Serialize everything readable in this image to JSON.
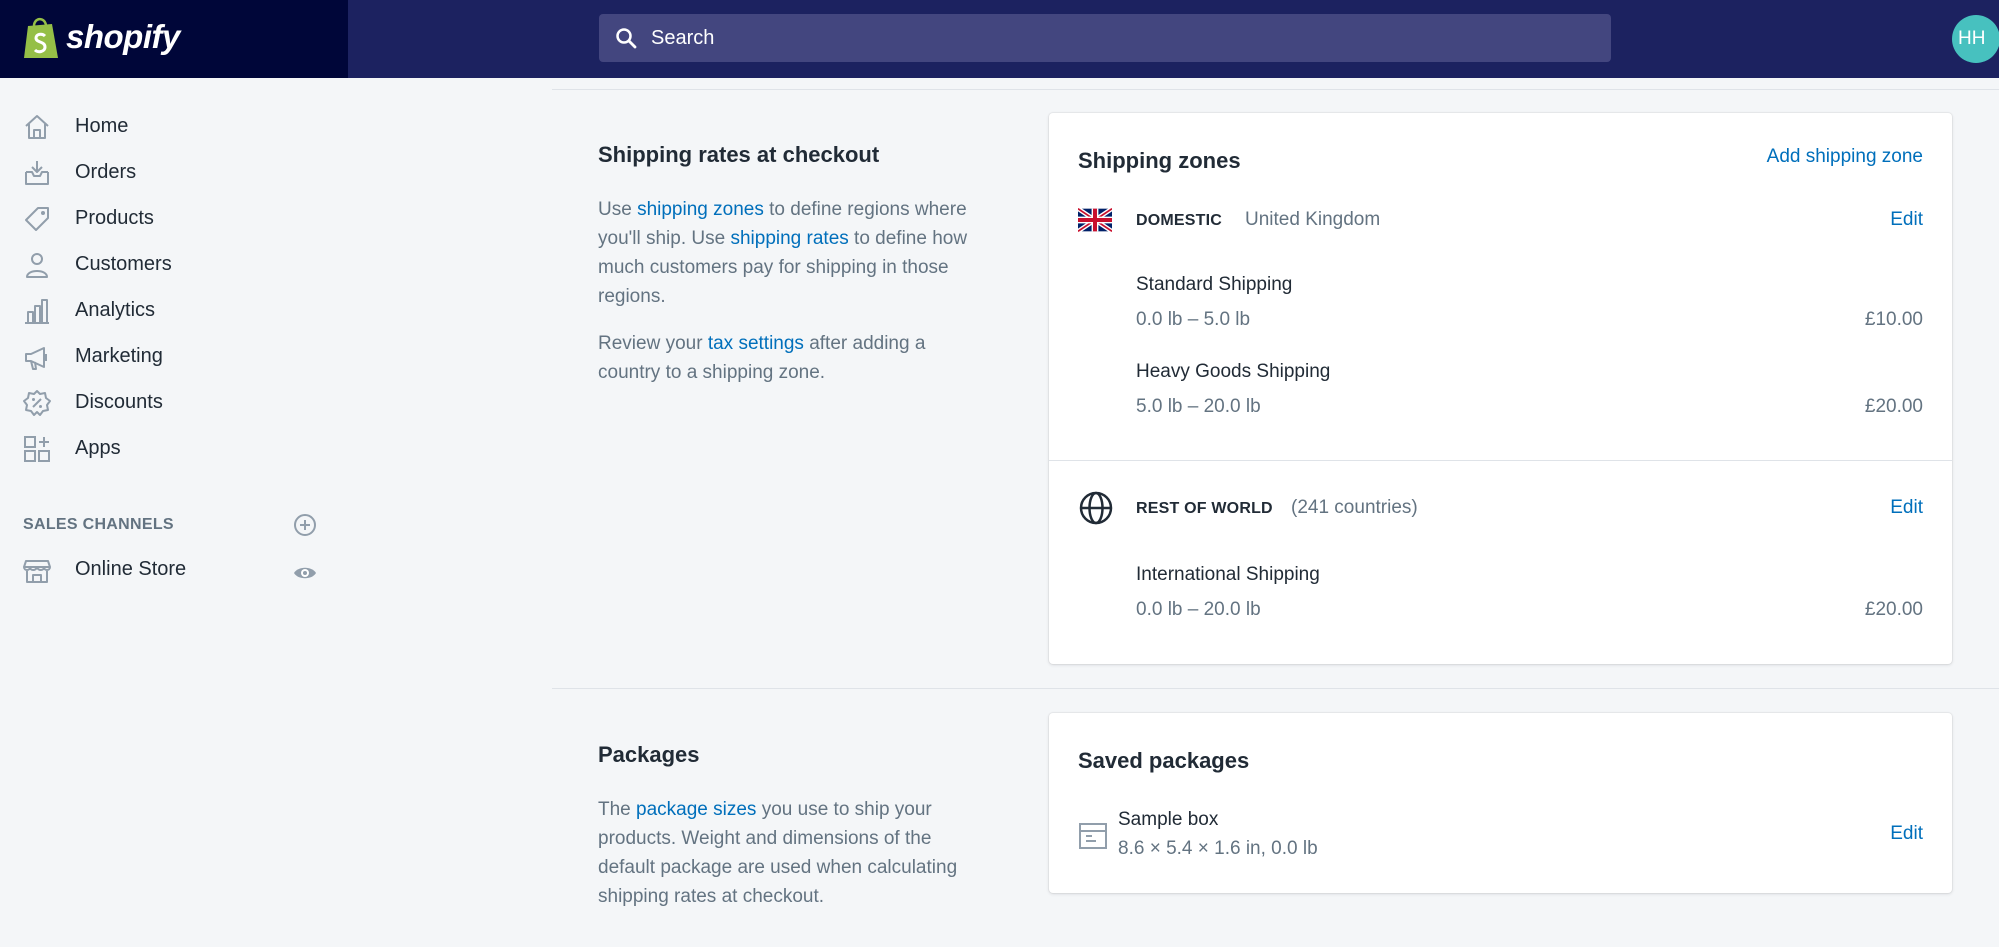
{
  "brand": {
    "name": "shopify"
  },
  "search": {
    "placeholder": "Search"
  },
  "user": {
    "initials": "HH"
  },
  "sidebar": {
    "items": [
      {
        "label": "Home",
        "icon": "home-icon"
      },
      {
        "label": "Orders",
        "icon": "orders-icon"
      },
      {
        "label": "Products",
        "icon": "tag-icon"
      },
      {
        "label": "Customers",
        "icon": "person-icon"
      },
      {
        "label": "Analytics",
        "icon": "bar-chart-icon"
      },
      {
        "label": "Marketing",
        "icon": "megaphone-icon"
      },
      {
        "label": "Discounts",
        "icon": "discount-icon"
      },
      {
        "label": "Apps",
        "icon": "apps-icon"
      }
    ],
    "sales_channels": {
      "title": "SALES CHANNELS",
      "items": [
        {
          "label": "Online Store",
          "icon": "store-icon"
        }
      ]
    }
  },
  "shipping_rates": {
    "title": "Shipping rates at checkout",
    "desc1": {
      "t1": "Use ",
      "link1": "shipping zones",
      "t2": " to define regions where you'll ship. Use ",
      "link2": "shipping rates",
      "t3": " to define how much customers pay for shipping in those regions."
    },
    "desc2": {
      "t1": "Review your ",
      "link1": "tax settings",
      "t2": " after adding a country to a shipping zone."
    }
  },
  "shipping_zones": {
    "title": "Shipping zones",
    "add_label": "Add shipping zone",
    "zones": [
      {
        "name": "DOMESTIC",
        "subtitle": "United Kingdom",
        "edit": "Edit",
        "icon": "uk-flag-icon",
        "rates": [
          {
            "name": "Standard Shipping",
            "range": "0.0 lb – 5.0 lb",
            "price": "£10.00"
          },
          {
            "name": "Heavy Goods Shipping",
            "range": "5.0 lb – 20.0 lb",
            "price": "£20.00"
          }
        ]
      },
      {
        "name": "REST OF WORLD",
        "subtitle": "(241 countries)",
        "edit": "Edit",
        "icon": "globe-icon",
        "rates": [
          {
            "name": "International Shipping",
            "range": "0.0 lb – 20.0 lb",
            "price": "£20.00"
          }
        ]
      }
    ]
  },
  "packages": {
    "title": "Packages",
    "desc": {
      "t1": "The ",
      "link1": "package sizes",
      "t2": " you use to ship your products. Weight and dimensions of the default package are used when calculating shipping rates at checkout."
    }
  },
  "saved_packages": {
    "title": "Saved packages",
    "items": [
      {
        "name": "Sample box",
        "dims": "8.6 × 5.4 × 1.6 in, 0.0 lb",
        "edit": "Edit",
        "icon": "box-icon"
      }
    ]
  },
  "colors": {
    "topbar": "#1c2260",
    "logo_bg": "#000639",
    "link": "#006fbb",
    "avatar": "#47c1bf",
    "shopify_green": "#95bf47"
  }
}
